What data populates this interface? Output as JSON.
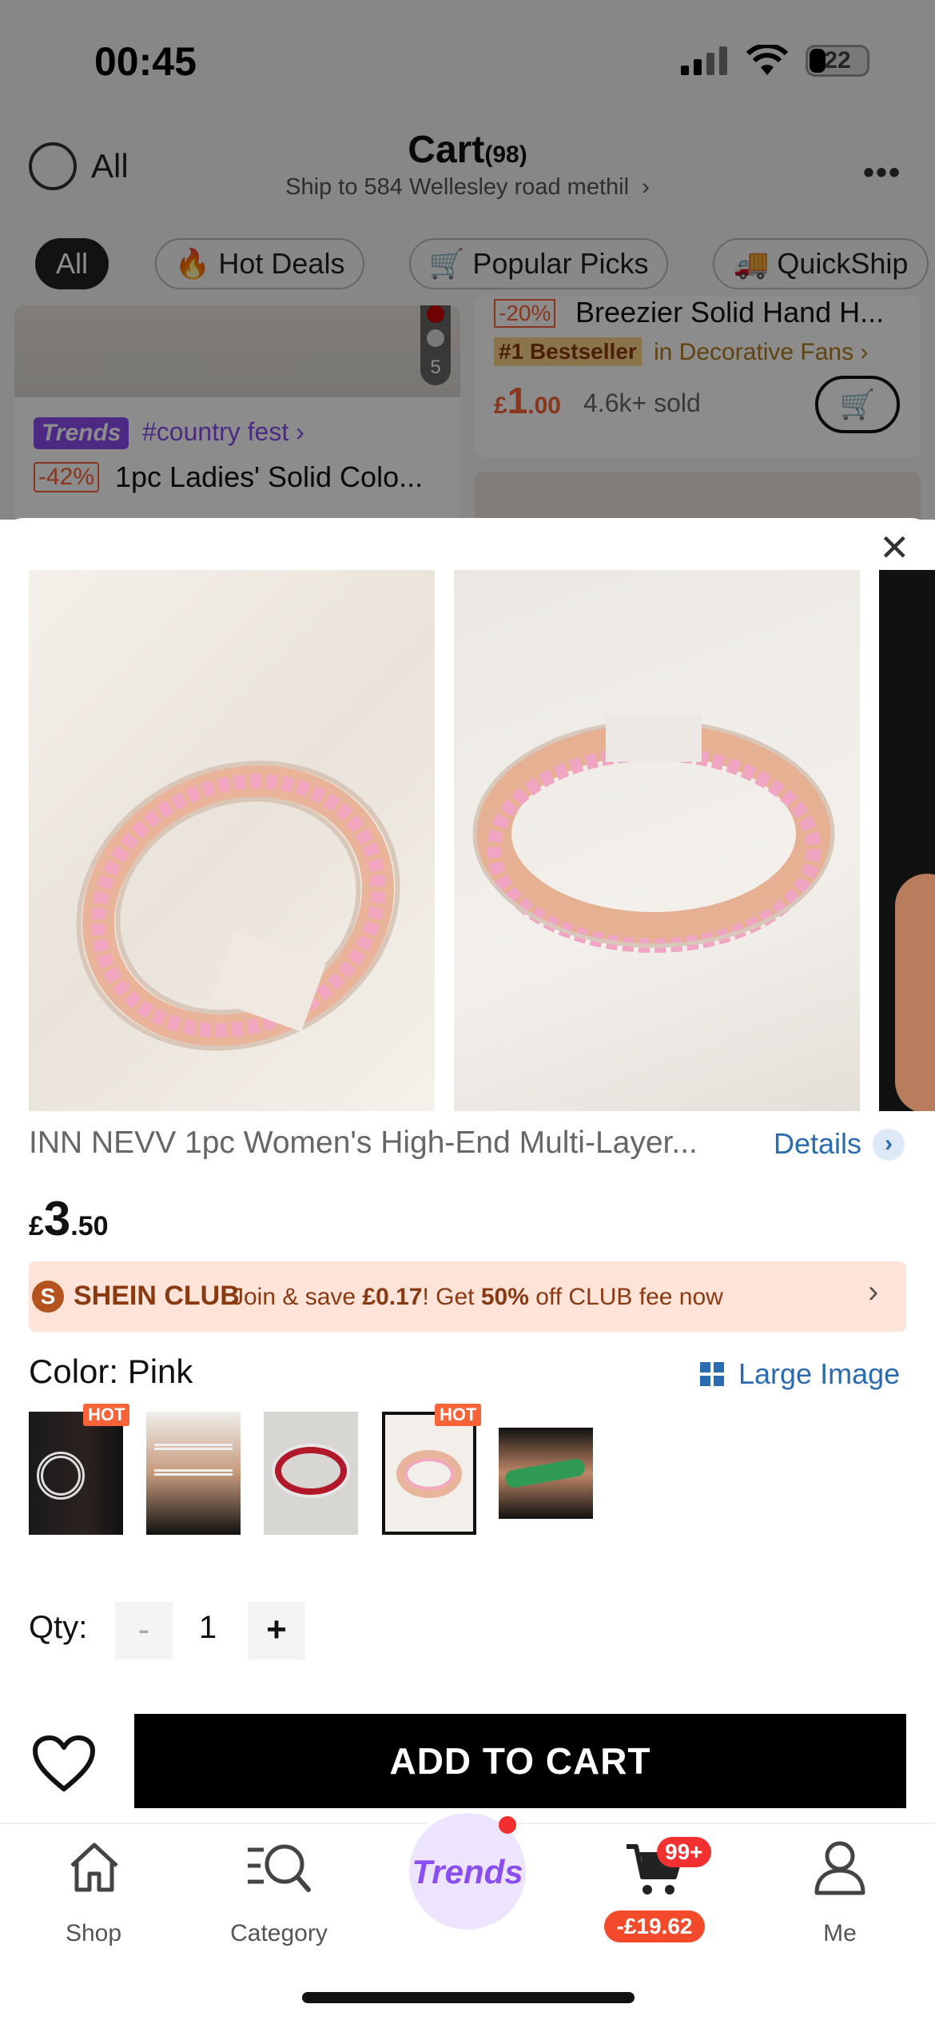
{
  "status_bar": {
    "time": "00:45",
    "battery": "22"
  },
  "cart_header": {
    "select_all_label": "All",
    "title": "Cart",
    "count": "(98)",
    "ship_to": "Ship to 584 Wellesley road methil",
    "more_icon": "more-dots-icon"
  },
  "filter_chips": [
    {
      "label": "All",
      "active": true
    },
    {
      "label": "Hot Deals",
      "icon": "flame-icon"
    },
    {
      "label": "Popular Picks",
      "icon": "cart-icon"
    },
    {
      "label": "QuickShip",
      "icon": "truck-icon"
    }
  ],
  "background_items": {
    "left": {
      "tag": "Trends",
      "tag_text": "#country fest",
      "discount": "-42%",
      "name": "1pc Ladies' Solid Colo...",
      "img_count": "5"
    },
    "right": {
      "discount": "-20%",
      "name": "Breezier Solid Hand H...",
      "rank": "#1 Bestseller",
      "rank_cat": "in Decorative Fans",
      "price_symbol": "£",
      "price_int": "1",
      "price_dec": ".00",
      "sold": "4.6k+ sold"
    }
  },
  "product": {
    "title": "INN NEVV 1pc Women's High-End Multi-Layer...",
    "details_label": "Details",
    "price": {
      "currency": "£",
      "int": "3",
      "dec": ".50"
    },
    "club": {
      "badge": "S",
      "name": "SHEIN CLUB",
      "msg_pre": "Join & save ",
      "save": "£0.17",
      "msg_mid": "! Get ",
      "pct": "50%",
      "msg_post": " off CLUB fee now"
    },
    "color_label": "Color: Pink",
    "large_image_label": "Large Image",
    "swatches": [
      {
        "name": "silver-multi-row",
        "hot": "HOT"
      },
      {
        "name": "silver-multi-strand"
      },
      {
        "name": "red-stone"
      },
      {
        "name": "pink",
        "hot": "HOT",
        "selected": true
      },
      {
        "name": "green-stone"
      }
    ],
    "qty_label": "Qty:",
    "qty": "1",
    "minus": "-",
    "plus": "+",
    "add_to_cart": "ADD TO CART"
  },
  "tabbar": {
    "shop": "Shop",
    "category": "Category",
    "trends": "Trends",
    "cart_badge": "99+",
    "cart_amount": "-£19.62",
    "me": "Me"
  },
  "colors": {
    "accent": "#2b6cb0",
    "sale": "#fa6338",
    "club_bg": "#fde3d8",
    "trends": "#8a4df0"
  }
}
